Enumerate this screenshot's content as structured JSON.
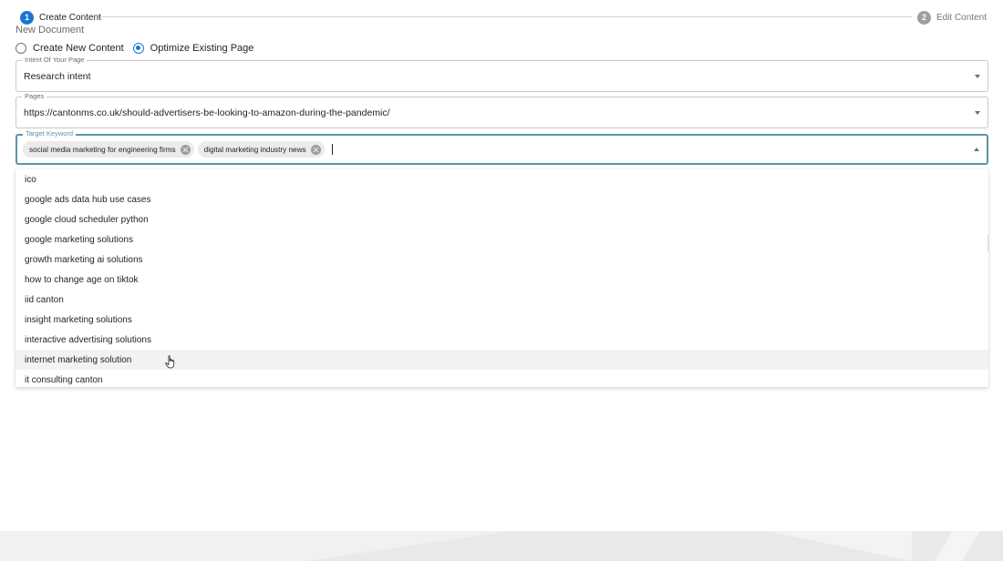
{
  "stepper": {
    "steps": [
      {
        "number": "1",
        "label": "Create Content",
        "active": true
      },
      {
        "number": "2",
        "label": "Edit Content",
        "active": false
      }
    ]
  },
  "document_title": "New Document",
  "mode": {
    "options": [
      {
        "label": "Create New Content",
        "checked": false
      },
      {
        "label": "Optimize Existing Page",
        "checked": true
      }
    ]
  },
  "intent_field": {
    "legend": "Intent Of Your Page",
    "value": "Research intent"
  },
  "pages_field": {
    "legend": "Pages",
    "value": "https://cantonms.co.uk/should-advertisers-be-looking-to-amazon-during-the-pandemic/"
  },
  "keyword_field": {
    "legend": "Target Keyword",
    "chips": [
      "social media marketing for engineering firms",
      "digital marketing industry news"
    ]
  },
  "keyword_options": [
    "ico",
    "google ads data hub use cases",
    "google cloud scheduler python",
    "google marketing solutions",
    "growth marketing ai solutions",
    "how to change age on tiktok",
    "iid canton",
    "insight marketing solutions",
    "interactive advertising solutions",
    "internet marketing solution",
    "it consulting canton"
  ],
  "hovered_option": "internet marketing solution",
  "colors": {
    "primary": "#1976d2",
    "focus_border": "#5b95a8",
    "inactive_step": "#9e9e9e"
  },
  "icons": {
    "dropdown": "caret-down-icon",
    "dropdown_open": "caret-up-icon",
    "chip_delete": "cancel-circle-icon",
    "pointer": "hand-pointer-icon"
  }
}
